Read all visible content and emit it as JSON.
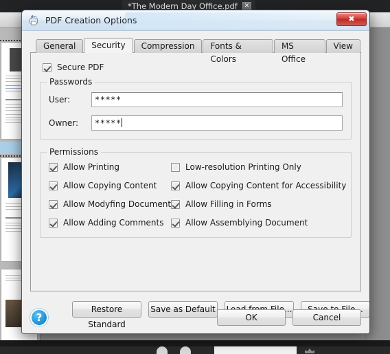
{
  "background": {
    "document_tab": {
      "title": "*The Modern Day Office.pdf",
      "close_icon": "close-icon",
      "close_glyph": "✕"
    },
    "collapse_button": {
      "glyph": "◂◂",
      "name": "collapse-panel-button"
    }
  },
  "dialog": {
    "title": "PDF Creation Options",
    "app_icon": "pdf-printer-icon",
    "close_button": {
      "label": "✖",
      "name": "window-close-button"
    },
    "tabs": [
      {
        "label": "General",
        "active": false
      },
      {
        "label": "Security",
        "active": true
      },
      {
        "label": "Compression",
        "active": false
      },
      {
        "label": "Fonts & Colors",
        "active": false
      },
      {
        "label": "MS Office",
        "active": false
      },
      {
        "label": "View",
        "active": false
      }
    ],
    "security": {
      "secure_pdf": {
        "label": "Secure PDF",
        "checked": true
      },
      "passwords": {
        "group_label": "Passwords",
        "user": {
          "label": "User:",
          "value": "*****",
          "placeholder": "",
          "focused": false
        },
        "owner": {
          "label": "Owner:",
          "value": "*****",
          "placeholder": "",
          "focused": true
        }
      },
      "permissions": {
        "group_label": "Permissions",
        "left_column": [
          {
            "label": "Allow Printing",
            "checked": true
          },
          {
            "label": "Allow Copying Content",
            "checked": true
          },
          {
            "label": "Allow Modyfing Document",
            "checked": true
          },
          {
            "label": "Allow Adding Comments",
            "checked": true
          }
        ],
        "right_column": [
          {
            "label": "Low-resolution Printing Only",
            "checked": false
          },
          {
            "label": "Allow Copying Content for Accessibility",
            "checked": true
          },
          {
            "label": "Allow Filling in Forms",
            "checked": true
          },
          {
            "label": "Allow Assemblying Document",
            "checked": true
          }
        ]
      }
    },
    "preset_buttons": [
      {
        "label": "Restore Standard",
        "name": "restore-standard-button"
      },
      {
        "label": "Save as Default",
        "name": "save-as-default-button"
      },
      {
        "label": "Load from File...",
        "name": "load-from-file-button"
      },
      {
        "label": "Save to File...",
        "name": "save-to-file-button"
      }
    ],
    "footer": {
      "help_label": "?",
      "ok_label": "OK",
      "cancel_label": "Cancel"
    }
  },
  "colors": {
    "accent_blue": "#1a8fd4",
    "close_red": "#d6433c",
    "dialog_face": "#f0f0f0",
    "selection_blue": "#aacfe8"
  }
}
